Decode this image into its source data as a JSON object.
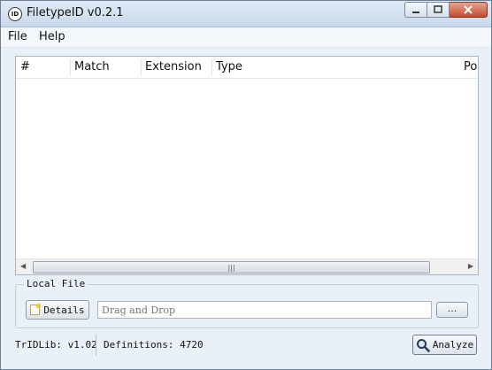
{
  "window": {
    "title": "FiletypeID v0.2.1",
    "app_icon_text": "ID"
  },
  "menu": [
    "File",
    "Help"
  ],
  "table": {
    "columns": [
      "#",
      "Match",
      "Extension",
      "Type",
      "Poi"
    ],
    "rows": []
  },
  "local_file": {
    "group_label": "Local File",
    "details_label": "Details",
    "drop_placeholder": "Drag and Drop",
    "browse_label": "..."
  },
  "status": {
    "lib": "TrIDLib: v1.02",
    "definitions": "Definitions: 4720"
  },
  "analyze_label": "Analyze",
  "icons": {
    "app": "app-icon",
    "details": "details-icon",
    "analyze": "magnifier-icon"
  },
  "colors": {
    "accent": "#c44a30",
    "window_bg": "#eaf0f7"
  }
}
